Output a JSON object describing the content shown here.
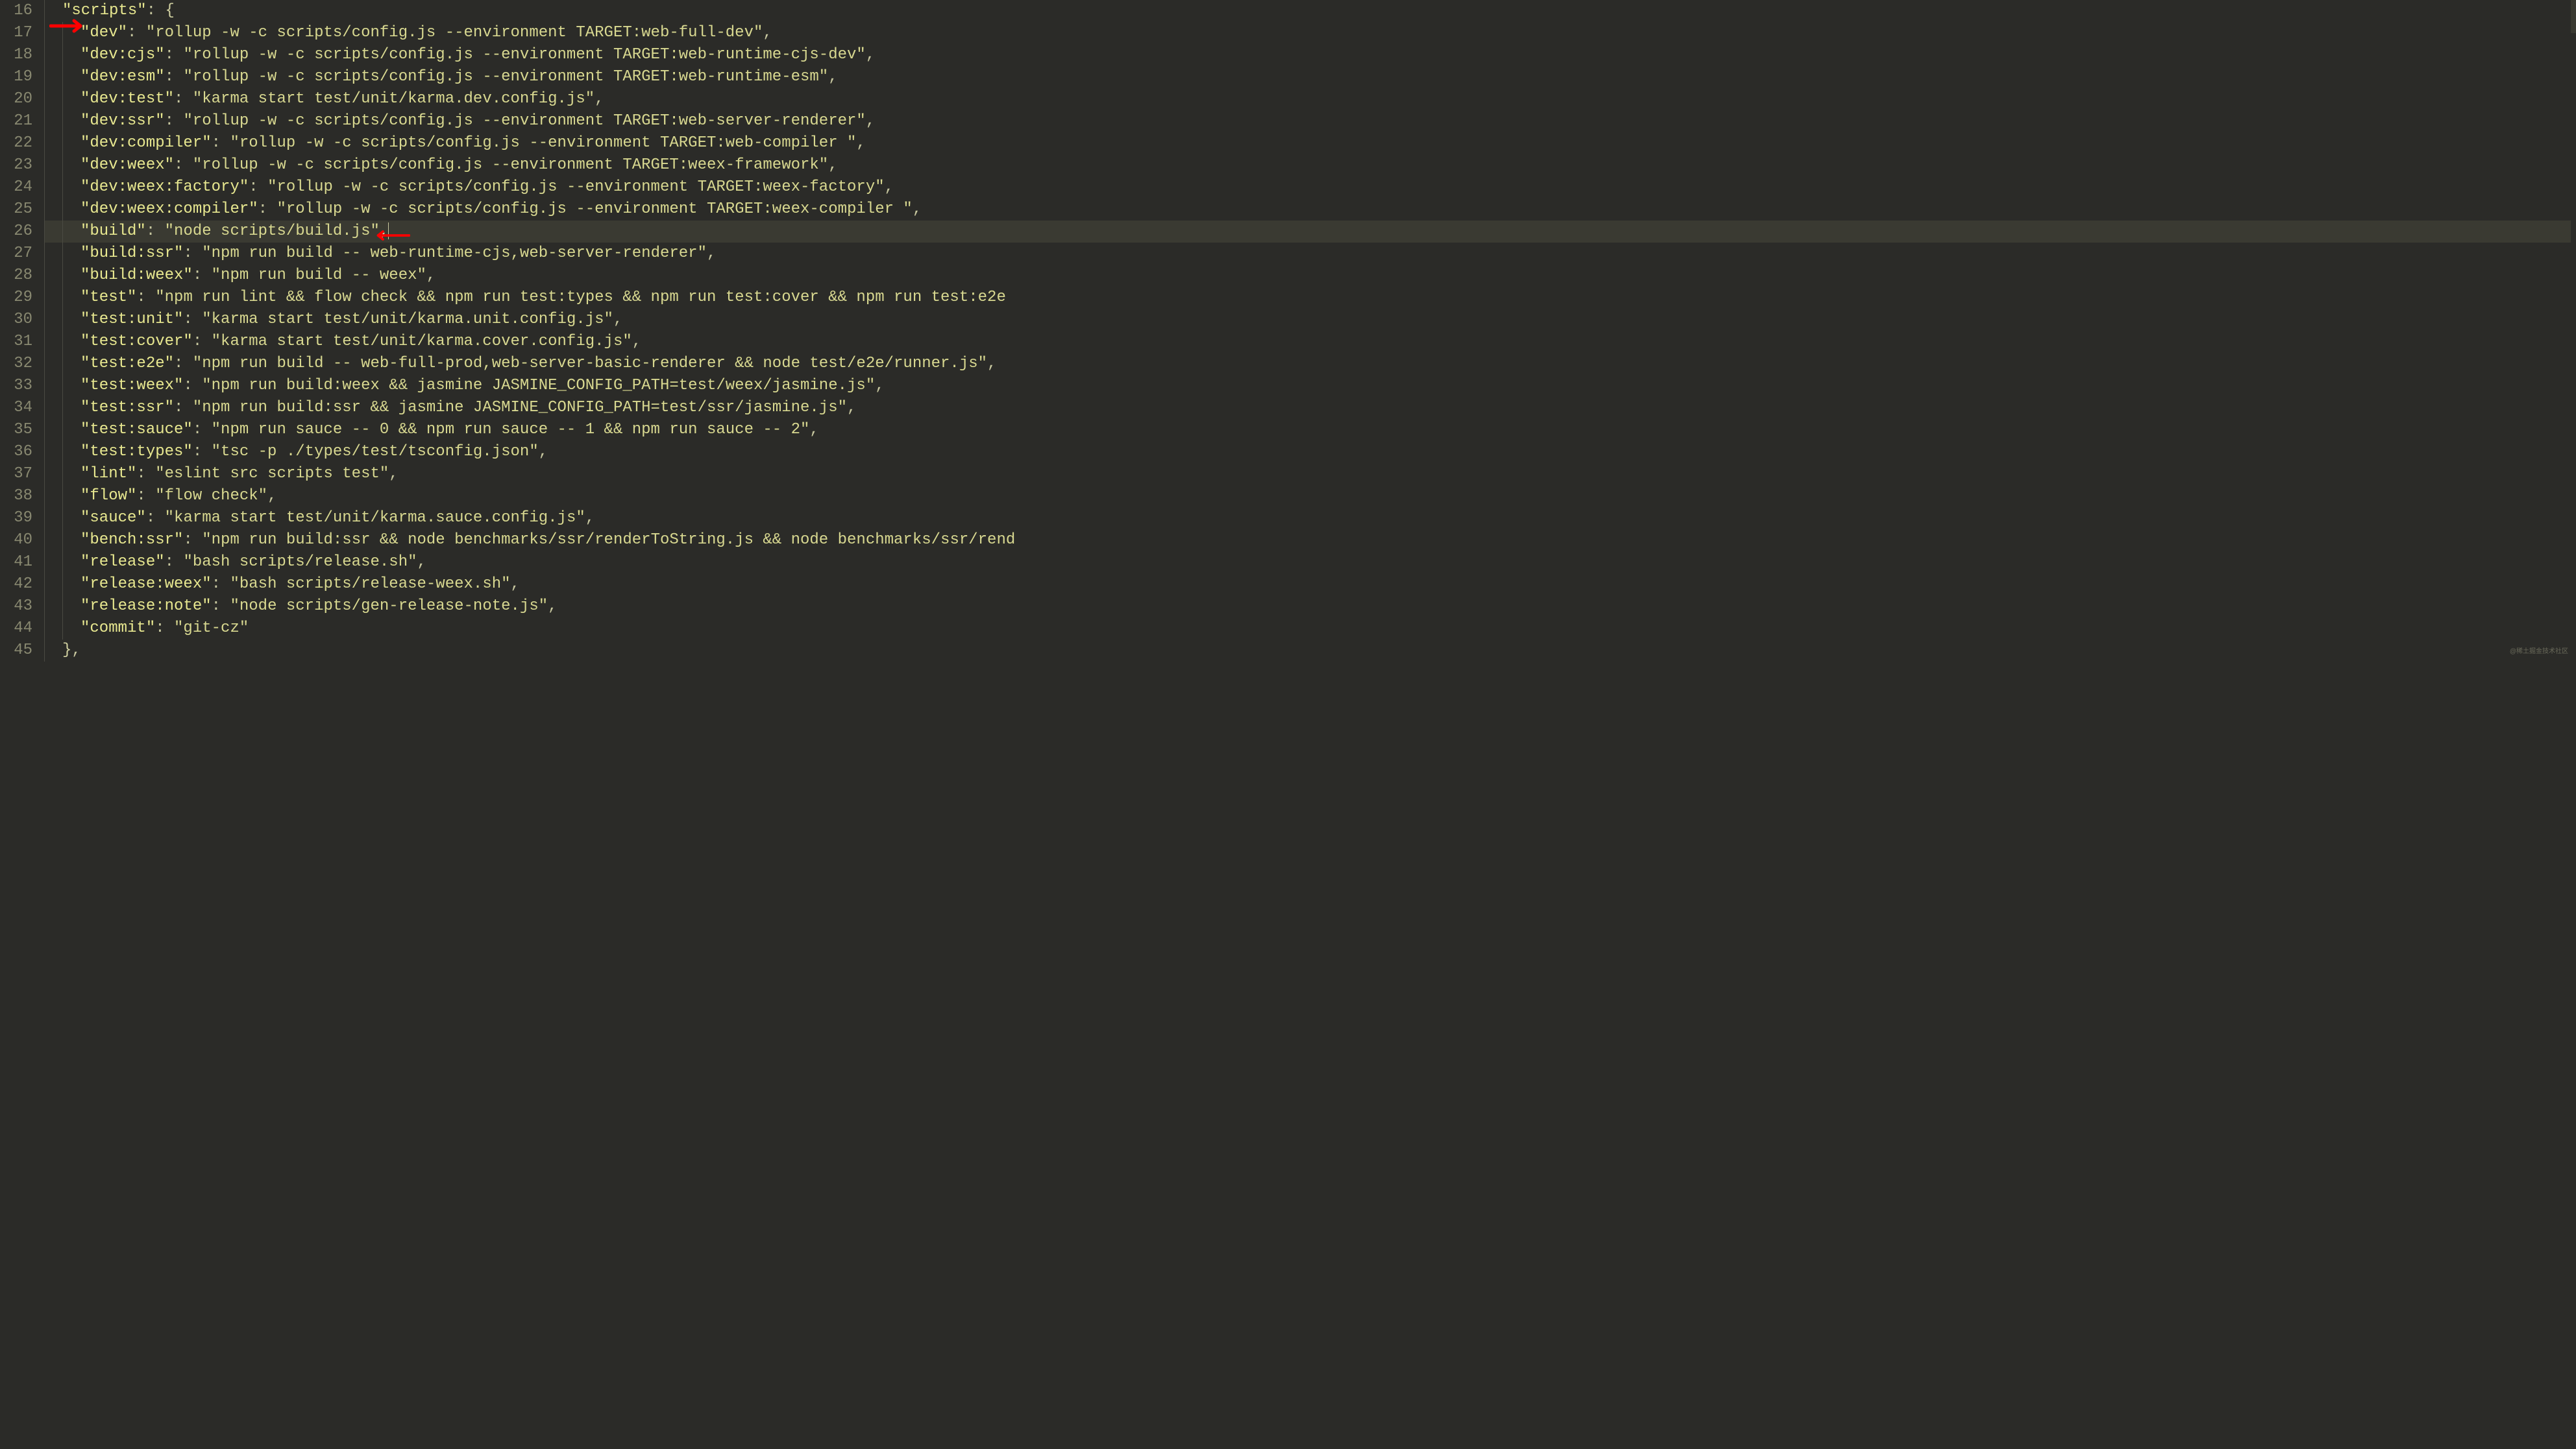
{
  "startLine": 16,
  "highlightedLine": 26,
  "watermark": "@稀土掘金技术社区",
  "arrows": [
    {
      "id": "arrow1",
      "direction": "right"
    },
    {
      "id": "arrow2",
      "direction": "left"
    }
  ],
  "lines": [
    {
      "indent": 1,
      "parts": [
        {
          "t": "key",
          "v": "\"scripts\""
        },
        {
          "t": "punct",
          "v": ": "
        },
        {
          "t": "brace",
          "v": "{"
        }
      ]
    },
    {
      "indent": 2,
      "parts": [
        {
          "t": "key",
          "v": "\"dev\""
        },
        {
          "t": "punct",
          "v": ": "
        },
        {
          "t": "string",
          "v": "\"rollup -w -c scripts/config.js --environment TARGET:web-full-dev\""
        },
        {
          "t": "punct",
          "v": ","
        }
      ]
    },
    {
      "indent": 2,
      "parts": [
        {
          "t": "key",
          "v": "\"dev:cjs\""
        },
        {
          "t": "punct",
          "v": ": "
        },
        {
          "t": "string",
          "v": "\"rollup -w -c scripts/config.js --environment TARGET:web-runtime-cjs-dev\""
        },
        {
          "t": "punct",
          "v": ","
        }
      ]
    },
    {
      "indent": 2,
      "parts": [
        {
          "t": "key",
          "v": "\"dev:esm\""
        },
        {
          "t": "punct",
          "v": ": "
        },
        {
          "t": "string",
          "v": "\"rollup -w -c scripts/config.js --environment TARGET:web-runtime-esm\""
        },
        {
          "t": "punct",
          "v": ","
        }
      ]
    },
    {
      "indent": 2,
      "parts": [
        {
          "t": "key",
          "v": "\"dev:test\""
        },
        {
          "t": "punct",
          "v": ": "
        },
        {
          "t": "string",
          "v": "\"karma start test/unit/karma.dev.config.js\""
        },
        {
          "t": "punct",
          "v": ","
        }
      ]
    },
    {
      "indent": 2,
      "parts": [
        {
          "t": "key",
          "v": "\"dev:ssr\""
        },
        {
          "t": "punct",
          "v": ": "
        },
        {
          "t": "string",
          "v": "\"rollup -w -c scripts/config.js --environment TARGET:web-server-renderer\""
        },
        {
          "t": "punct",
          "v": ","
        }
      ]
    },
    {
      "indent": 2,
      "parts": [
        {
          "t": "key",
          "v": "\"dev:compiler\""
        },
        {
          "t": "punct",
          "v": ": "
        },
        {
          "t": "string",
          "v": "\"rollup -w -c scripts/config.js --environment TARGET:web-compiler \""
        },
        {
          "t": "punct",
          "v": ","
        }
      ]
    },
    {
      "indent": 2,
      "parts": [
        {
          "t": "key",
          "v": "\"dev:weex\""
        },
        {
          "t": "punct",
          "v": ": "
        },
        {
          "t": "string",
          "v": "\"rollup -w -c scripts/config.js --environment TARGET:weex-framework\""
        },
        {
          "t": "punct",
          "v": ","
        }
      ]
    },
    {
      "indent": 2,
      "parts": [
        {
          "t": "key",
          "v": "\"dev:weex:factory\""
        },
        {
          "t": "punct",
          "v": ": "
        },
        {
          "t": "string",
          "v": "\"rollup -w -c scripts/config.js --environment TARGET:weex-factory\""
        },
        {
          "t": "punct",
          "v": ","
        }
      ]
    },
    {
      "indent": 2,
      "parts": [
        {
          "t": "key",
          "v": "\"dev:weex:compiler\""
        },
        {
          "t": "punct",
          "v": ": "
        },
        {
          "t": "string",
          "v": "\"rollup -w -c scripts/config.js --environment TARGET:weex-compiler \""
        },
        {
          "t": "punct",
          "v": ","
        }
      ]
    },
    {
      "indent": 2,
      "cursor": true,
      "parts": [
        {
          "t": "key",
          "v": "\"build\""
        },
        {
          "t": "punct",
          "v": ": "
        },
        {
          "t": "string",
          "v": "\"node scripts/build.js\""
        },
        {
          "t": "punct",
          "v": ","
        }
      ]
    },
    {
      "indent": 2,
      "parts": [
        {
          "t": "key",
          "v": "\"build:ssr\""
        },
        {
          "t": "punct",
          "v": ": "
        },
        {
          "t": "string",
          "v": "\"npm run build -- web-runtime-cjs,web-server-renderer\""
        },
        {
          "t": "punct",
          "v": ","
        }
      ]
    },
    {
      "indent": 2,
      "parts": [
        {
          "t": "key",
          "v": "\"build:weex\""
        },
        {
          "t": "punct",
          "v": ": "
        },
        {
          "t": "string",
          "v": "\"npm run build -- weex\""
        },
        {
          "t": "punct",
          "v": ","
        }
      ]
    },
    {
      "indent": 2,
      "parts": [
        {
          "t": "key",
          "v": "\"test\""
        },
        {
          "t": "punct",
          "v": ": "
        },
        {
          "t": "string",
          "v": "\"npm run lint && flow check && npm run test:types && npm run test:cover && npm run test:e2e"
        }
      ]
    },
    {
      "indent": 2,
      "parts": [
        {
          "t": "key",
          "v": "\"test:unit\""
        },
        {
          "t": "punct",
          "v": ": "
        },
        {
          "t": "string",
          "v": "\"karma start test/unit/karma.unit.config.js\""
        },
        {
          "t": "punct",
          "v": ","
        }
      ]
    },
    {
      "indent": 2,
      "parts": [
        {
          "t": "key",
          "v": "\"test:cover\""
        },
        {
          "t": "punct",
          "v": ": "
        },
        {
          "t": "string",
          "v": "\"karma start test/unit/karma.cover.config.js\""
        },
        {
          "t": "punct",
          "v": ","
        }
      ]
    },
    {
      "indent": 2,
      "parts": [
        {
          "t": "key",
          "v": "\"test:e2e\""
        },
        {
          "t": "punct",
          "v": ": "
        },
        {
          "t": "string",
          "v": "\"npm run build -- web-full-prod,web-server-basic-renderer && node test/e2e/runner.js\""
        },
        {
          "t": "punct",
          "v": ","
        }
      ]
    },
    {
      "indent": 2,
      "parts": [
        {
          "t": "key",
          "v": "\"test:weex\""
        },
        {
          "t": "punct",
          "v": ": "
        },
        {
          "t": "string",
          "v": "\"npm run build:weex && jasmine JASMINE_CONFIG_PATH=test/weex/jasmine.js\""
        },
        {
          "t": "punct",
          "v": ","
        }
      ]
    },
    {
      "indent": 2,
      "parts": [
        {
          "t": "key",
          "v": "\"test:ssr\""
        },
        {
          "t": "punct",
          "v": ": "
        },
        {
          "t": "string",
          "v": "\"npm run build:ssr && jasmine JASMINE_CONFIG_PATH=test/ssr/jasmine.js\""
        },
        {
          "t": "punct",
          "v": ","
        }
      ]
    },
    {
      "indent": 2,
      "parts": [
        {
          "t": "key",
          "v": "\"test:sauce\""
        },
        {
          "t": "punct",
          "v": ": "
        },
        {
          "t": "string",
          "v": "\"npm run sauce -- 0 && npm run sauce -- 1 && npm run sauce -- 2\""
        },
        {
          "t": "punct",
          "v": ","
        }
      ]
    },
    {
      "indent": 2,
      "parts": [
        {
          "t": "key",
          "v": "\"test:types\""
        },
        {
          "t": "punct",
          "v": ": "
        },
        {
          "t": "string",
          "v": "\"tsc -p ./types/test/tsconfig.json\""
        },
        {
          "t": "punct",
          "v": ","
        }
      ]
    },
    {
      "indent": 2,
      "parts": [
        {
          "t": "key",
          "v": "\"lint\""
        },
        {
          "t": "punct",
          "v": ": "
        },
        {
          "t": "string",
          "v": "\"eslint src scripts test\""
        },
        {
          "t": "punct",
          "v": ","
        }
      ]
    },
    {
      "indent": 2,
      "parts": [
        {
          "t": "key",
          "v": "\"flow\""
        },
        {
          "t": "punct",
          "v": ": "
        },
        {
          "t": "string",
          "v": "\"flow check\""
        },
        {
          "t": "punct",
          "v": ","
        }
      ]
    },
    {
      "indent": 2,
      "parts": [
        {
          "t": "key",
          "v": "\"sauce\""
        },
        {
          "t": "punct",
          "v": ": "
        },
        {
          "t": "string",
          "v": "\"karma start test/unit/karma.sauce.config.js\""
        },
        {
          "t": "punct",
          "v": ","
        }
      ]
    },
    {
      "indent": 2,
      "parts": [
        {
          "t": "key",
          "v": "\"bench:ssr\""
        },
        {
          "t": "punct",
          "v": ": "
        },
        {
          "t": "string",
          "v": "\"npm run build:ssr && node benchmarks/ssr/renderToString.js && node benchmarks/ssr/rend"
        }
      ]
    },
    {
      "indent": 2,
      "parts": [
        {
          "t": "key",
          "v": "\"release\""
        },
        {
          "t": "punct",
          "v": ": "
        },
        {
          "t": "string",
          "v": "\"bash scripts/release.sh\""
        },
        {
          "t": "punct",
          "v": ","
        }
      ]
    },
    {
      "indent": 2,
      "parts": [
        {
          "t": "key",
          "v": "\"release:weex\""
        },
        {
          "t": "punct",
          "v": ": "
        },
        {
          "t": "string",
          "v": "\"bash scripts/release-weex.sh\""
        },
        {
          "t": "punct",
          "v": ","
        }
      ]
    },
    {
      "indent": 2,
      "parts": [
        {
          "t": "key",
          "v": "\"release:note\""
        },
        {
          "t": "punct",
          "v": ": "
        },
        {
          "t": "string",
          "v": "\"node scripts/gen-release-note.js\""
        },
        {
          "t": "punct",
          "v": ","
        }
      ]
    },
    {
      "indent": 2,
      "parts": [
        {
          "t": "key",
          "v": "\"commit\""
        },
        {
          "t": "punct",
          "v": ": "
        },
        {
          "t": "string",
          "v": "\"git-cz\""
        }
      ]
    },
    {
      "indent": 1,
      "parts": [
        {
          "t": "brace",
          "v": "}"
        },
        {
          "t": "punct",
          "v": ","
        }
      ]
    }
  ]
}
